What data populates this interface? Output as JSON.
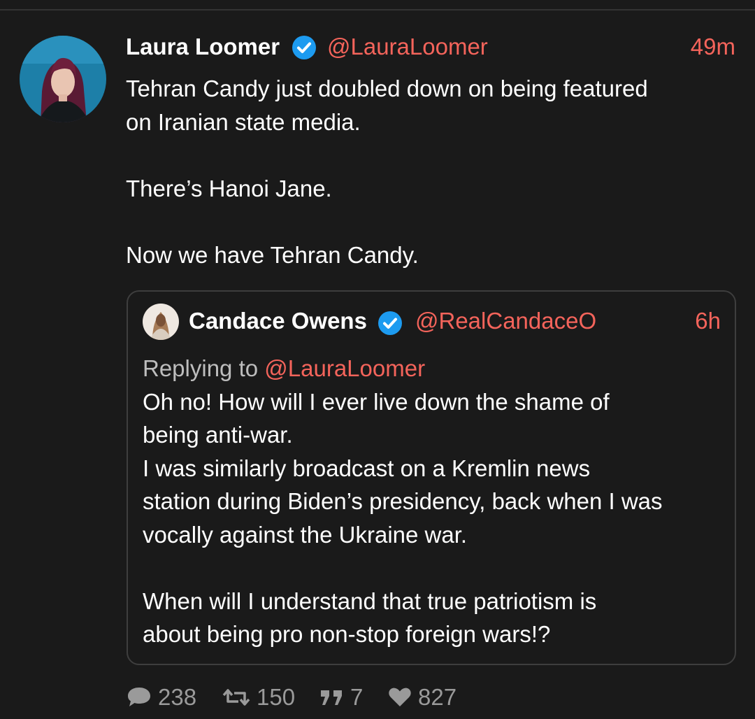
{
  "tweet": {
    "author": {
      "display_name": "Laura Loomer",
      "handle": "@LauraLoomer",
      "verified": true,
      "avatar_icon": "profile-photo"
    },
    "timestamp": "49m",
    "body_lines": [
      "Tehran Candy just doubled down on being featured",
      "on Iranian state media.",
      "",
      "There’s Hanoi Jane.",
      "",
      "Now we have Tehran Candy."
    ]
  },
  "quoted_tweet": {
    "author": {
      "display_name": "Candace Owens",
      "handle": "@RealCandaceO",
      "verified": true,
      "avatar_icon": "profile-photo"
    },
    "timestamp": "6h",
    "replying_to_label": "Replying to",
    "replying_to_handle": "@LauraLoomer",
    "body_lines": [
      "Oh no! How will I ever live down the shame of",
      "being anti-war.",
      "I was similarly broadcast on a Kremlin news",
      "station during Biden’s presidency, back when I was",
      "vocally against the Ukraine war.",
      "",
      "When will I understand that true patriotism is",
      "about being pro non-stop foreign wars!?"
    ]
  },
  "actions": {
    "replies": "238",
    "retweets": "150",
    "quotes": "7",
    "likes": "827",
    "icons": [
      "speech-bubble-icon",
      "retweet-icon",
      "quote-icon",
      "heart-icon"
    ]
  },
  "colors": {
    "background": "#1a1a1a",
    "accent": "#f4645b",
    "verified": "#1d9bf0",
    "muted": "#9a9a9a",
    "border": "#3e3e3e"
  }
}
